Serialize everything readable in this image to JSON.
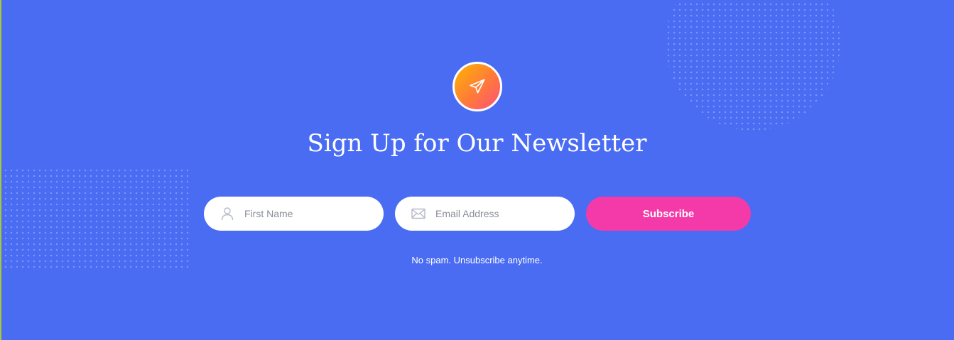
{
  "icons": {
    "badge": "paper-plane-icon",
    "first_name": "user-icon",
    "email": "envelope-icon"
  },
  "colors": {
    "background": "#4a6cf3",
    "button": "#f43aa8",
    "badge_gradient_start": "#ffb400",
    "badge_gradient_end": "#ff4f7a"
  },
  "newsletter": {
    "title": "Sign Up for Our Newsletter",
    "first_name_placeholder": "First Name",
    "email_placeholder": "Email Address",
    "subscribe_label": "Subscribe",
    "note": "No spam. Unsubscribe anytime."
  }
}
